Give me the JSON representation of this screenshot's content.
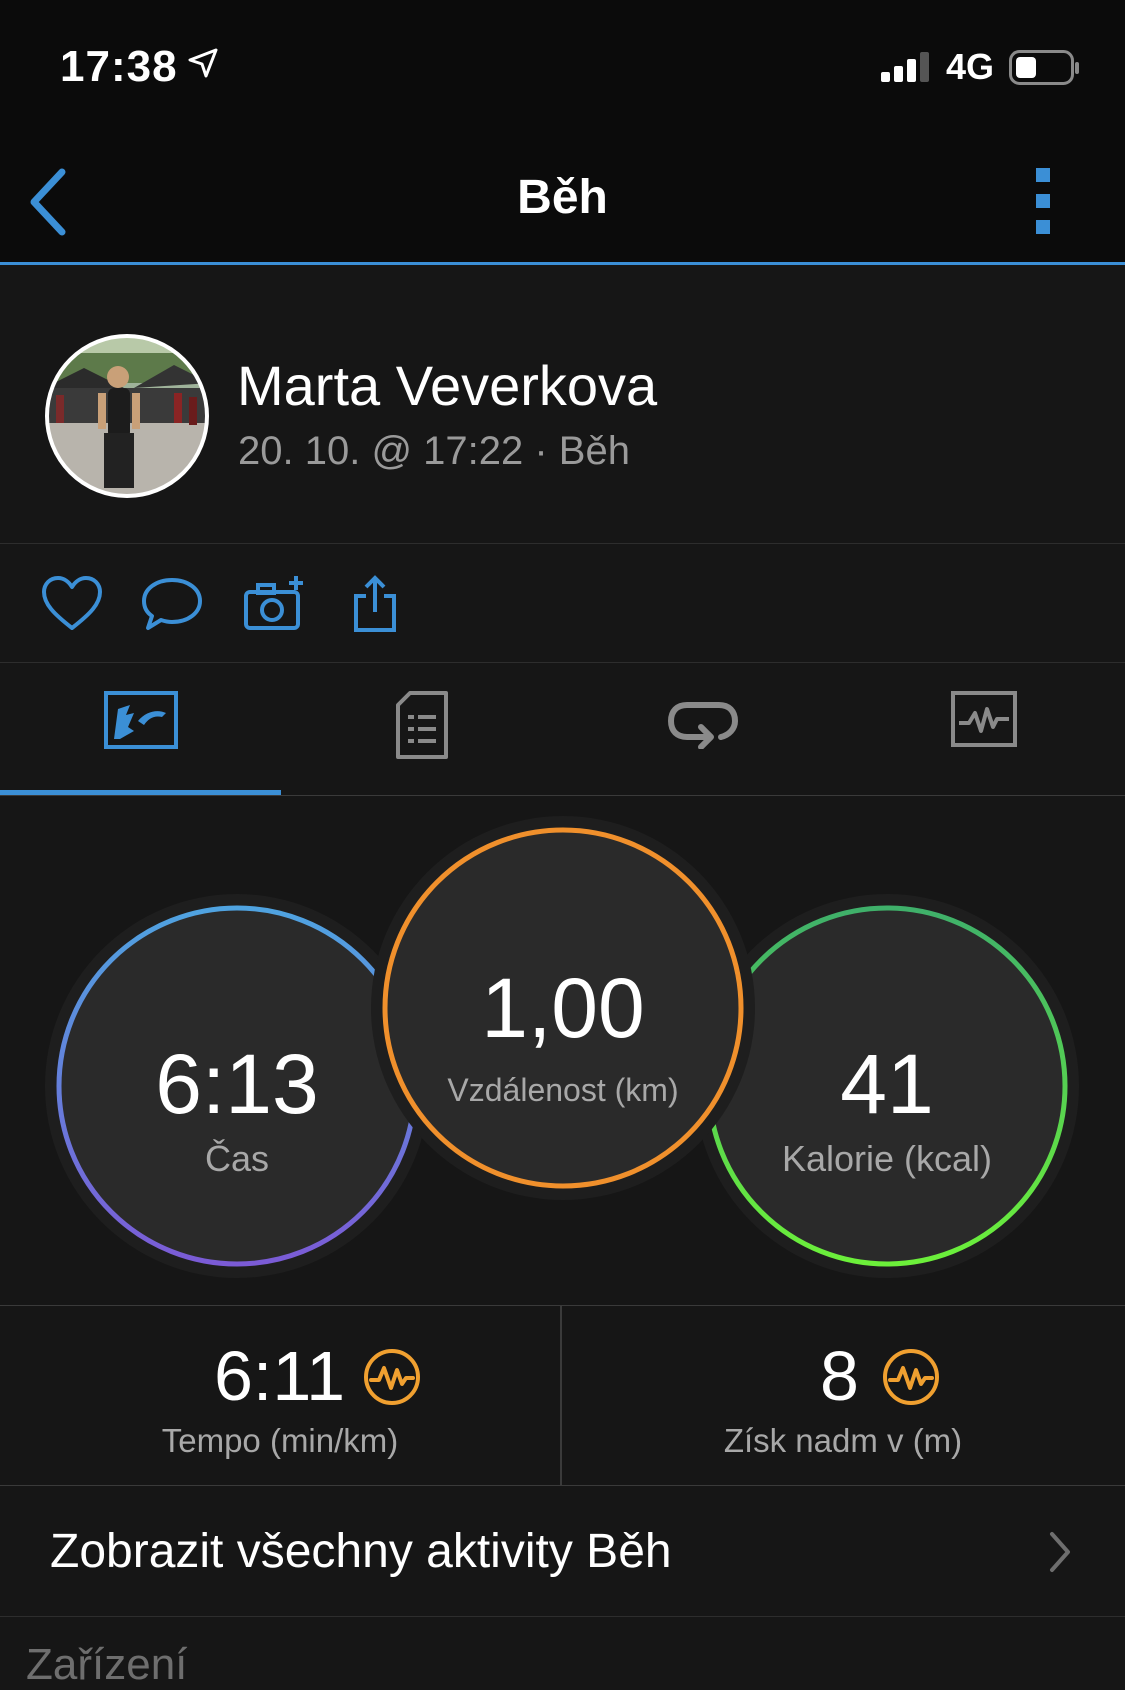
{
  "status_bar": {
    "time": "17:38",
    "network": "4G"
  },
  "nav": {
    "title": "Běh"
  },
  "profile": {
    "name": "Marta Veverkova",
    "meta": "20. 10. @ 17:22 · Běh"
  },
  "tabs": [
    {
      "icon": "stats-icon",
      "active": true
    },
    {
      "icon": "details-list-icon",
      "active": false
    },
    {
      "icon": "laps-icon",
      "active": false
    },
    {
      "icon": "chart-icon",
      "active": false
    }
  ],
  "metrics": {
    "time": {
      "value": "6:13",
      "label": "Čas",
      "color_start": "#4fa3e0",
      "color_end": "#7b5bd6"
    },
    "distance": {
      "value": "1,00",
      "label": "Vzdálenost (km)",
      "color": "#f0902c"
    },
    "calories": {
      "value": "41",
      "label": "Kalorie (kcal)",
      "color_start": "#3fb06a",
      "color_end": "#6cf03a"
    }
  },
  "stats": {
    "pace": {
      "value": "6:11",
      "label": "Tempo (min/km)"
    },
    "elevation": {
      "value": "8",
      "label": "Získ nadm v (m)"
    }
  },
  "links": {
    "all_activities": "Zobrazit všechny aktivity Běh"
  },
  "section": {
    "header": "Zařízení"
  },
  "colors": {
    "accent_blue": "#3b8fd6",
    "badge_orange": "#f0a030"
  }
}
